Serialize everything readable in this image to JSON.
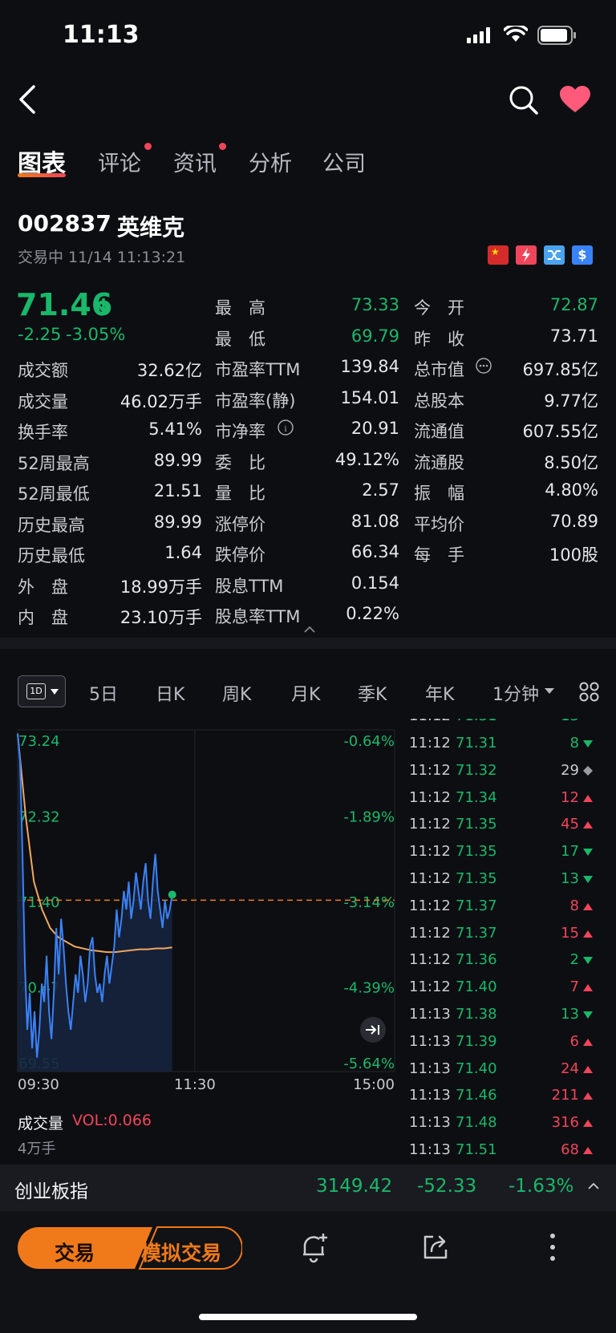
{
  "status": {
    "time": "11:13"
  },
  "tabs": [
    {
      "label": "图表",
      "active": true,
      "dot": false
    },
    {
      "label": "评论",
      "active": false,
      "dot": true
    },
    {
      "label": "资讯",
      "active": false,
      "dot": true
    },
    {
      "label": "分析",
      "active": false,
      "dot": false
    },
    {
      "label": "公司",
      "active": false,
      "dot": false
    }
  ],
  "stock": {
    "code": "002837",
    "name": "英维克",
    "status_text": "交易中 11/14 11:13:21",
    "price": "71.46",
    "change": "-2.25",
    "change_pct": "-3.05%"
  },
  "quote_left": [
    {
      "label": "成交额",
      "value": "32.62亿"
    },
    {
      "label": "成交量",
      "value": "46.02万手"
    },
    {
      "label": "换手率",
      "value": "5.41%"
    },
    {
      "label": "52周最高",
      "value": "89.99"
    },
    {
      "label": "52周最低",
      "value": "21.51"
    },
    {
      "label": "历史最高",
      "value": "89.99"
    },
    {
      "label": "历史最低",
      "value": "1.64"
    },
    {
      "label": "外　盘",
      "value": "18.99万手"
    },
    {
      "label": "内　盘",
      "value": "23.10万手"
    }
  ],
  "quote_mid": [
    {
      "label": "最　高",
      "value": "73.33",
      "color": "green"
    },
    {
      "label": "最　低",
      "value": "69.79",
      "color": "green"
    },
    {
      "label": "市盈率TTM",
      "value": "139.84",
      "color": ""
    },
    {
      "label": "市盈率(静)",
      "value": "154.01",
      "color": ""
    },
    {
      "label": "市净率",
      "value": "20.91",
      "color": ""
    },
    {
      "label": "委　比",
      "value": "49.12%",
      "color": ""
    },
    {
      "label": "量　比",
      "value": "2.57",
      "color": ""
    },
    {
      "label": "涨停价",
      "value": "81.08",
      "color": ""
    },
    {
      "label": "跌停价",
      "value": "66.34",
      "color": ""
    },
    {
      "label": "股息TTM",
      "value": "0.154",
      "color": ""
    },
    {
      "label": "股息率TTM",
      "value": "0.22%",
      "color": ""
    }
  ],
  "quote_right": [
    {
      "label": "今　开",
      "value": "72.87",
      "color": "green"
    },
    {
      "label": "昨　收",
      "value": "73.71",
      "color": ""
    },
    {
      "label": "总市值",
      "value": "697.85亿",
      "color": ""
    },
    {
      "label": "总股本",
      "value": "9.77亿",
      "color": ""
    },
    {
      "label": "流通值",
      "value": "607.55亿",
      "color": ""
    },
    {
      "label": "流通股",
      "value": "8.50亿",
      "color": ""
    },
    {
      "label": "振　幅",
      "value": "4.80%",
      "color": ""
    },
    {
      "label": "平均价",
      "value": "70.89",
      "color": ""
    },
    {
      "label": "每　手",
      "value": "100股",
      "color": ""
    }
  ],
  "period_tabs": [
    "1D",
    "5日",
    "日K",
    "周K",
    "月K",
    "季K",
    "年K",
    "1分钟"
  ],
  "chart_data": {
    "type": "line",
    "y_left_ticks": [
      "73.24",
      "72.32",
      "71.40",
      "70.47",
      "69.55"
    ],
    "y_right_ticks": [
      "-0.64%",
      "-1.89%",
      "-3.14%",
      "-4.39%",
      "-5.64%"
    ],
    "x_ticks": [
      "09:30",
      "11:30",
      "15:00"
    ],
    "ylim": [
      69.55,
      73.24
    ],
    "reference": 71.4,
    "series": [
      {
        "values": [
          73.2,
          72.9,
          71.9,
          70.7,
          70.0,
          70.4,
          69.8,
          70.2,
          69.7,
          70.0,
          70.5,
          70.3,
          70.8,
          70.2,
          69.9,
          70.4,
          71.1,
          70.6,
          71.2,
          70.9,
          70.5,
          70.2,
          70.0,
          70.3,
          70.6,
          70.4,
          70.8,
          70.6,
          70.3,
          70.5,
          70.9,
          71.0,
          70.6,
          70.4,
          70.5,
          70.3,
          70.6,
          70.8,
          70.5,
          70.7,
          70.9,
          71.3,
          71.0,
          71.2,
          71.5,
          71.3,
          71.6,
          71.2,
          71.4,
          71.7,
          71.5,
          71.3,
          71.6,
          71.8,
          71.4,
          71.2,
          71.6,
          71.9,
          71.5,
          71.3,
          71.1,
          71.4,
          71.2,
          71.3,
          71.46
        ]
      },
      {
        "values": [
          73.2,
          72.3,
          71.6,
          71.3,
          71.1,
          71.0,
          70.95,
          70.9,
          70.88,
          70.86,
          70.85,
          70.84,
          70.84,
          70.85,
          70.86,
          70.87,
          70.87,
          70.88,
          70.88,
          70.89
        ]
      }
    ]
  },
  "volume": {
    "label": "成交量",
    "indicator": "VOL:0.066",
    "axis": "4万手"
  },
  "ticks": [
    {
      "time": "11:12",
      "price": "71.31",
      "qty": "8",
      "dir": "down"
    },
    {
      "time": "11:12",
      "price": "71.32",
      "qty": "29",
      "dir": "flat"
    },
    {
      "time": "11:12",
      "price": "71.34",
      "qty": "12",
      "dir": "up"
    },
    {
      "time": "11:12",
      "price": "71.35",
      "qty": "45",
      "dir": "up"
    },
    {
      "time": "11:12",
      "price": "71.35",
      "qty": "17",
      "dir": "down"
    },
    {
      "time": "11:12",
      "price": "71.35",
      "qty": "13",
      "dir": "down"
    },
    {
      "time": "11:12",
      "price": "71.37",
      "qty": "8",
      "dir": "up"
    },
    {
      "time": "11:12",
      "price": "71.37",
      "qty": "15",
      "dir": "up"
    },
    {
      "time": "11:12",
      "price": "71.36",
      "qty": "2",
      "dir": "down"
    },
    {
      "time": "11:12",
      "price": "71.40",
      "qty": "7",
      "dir": "up"
    },
    {
      "time": "11:13",
      "price": "71.38",
      "qty": "13",
      "dir": "down"
    },
    {
      "time": "11:13",
      "price": "71.39",
      "qty": "6",
      "dir": "up"
    },
    {
      "time": "11:13",
      "price": "71.40",
      "qty": "24",
      "dir": "up"
    },
    {
      "time": "11:13",
      "price": "71.46",
      "qty": "211",
      "dir": "up"
    },
    {
      "time": "11:13",
      "price": "71.48",
      "qty": "316",
      "dir": "up"
    },
    {
      "time": "11:13",
      "price": "71.51",
      "qty": "68",
      "dir": "up"
    }
  ],
  "index_bar": {
    "name": "创业板指",
    "value": "3149.42",
    "change": "-52.33",
    "pct": "-1.63%"
  },
  "footer": {
    "trade": "交易",
    "sim_trade": "模拟交易"
  },
  "colors": {
    "green": "#19b86a",
    "red": "#f0455a",
    "orange": "#f07a1a",
    "blue": "#3a82f7"
  }
}
